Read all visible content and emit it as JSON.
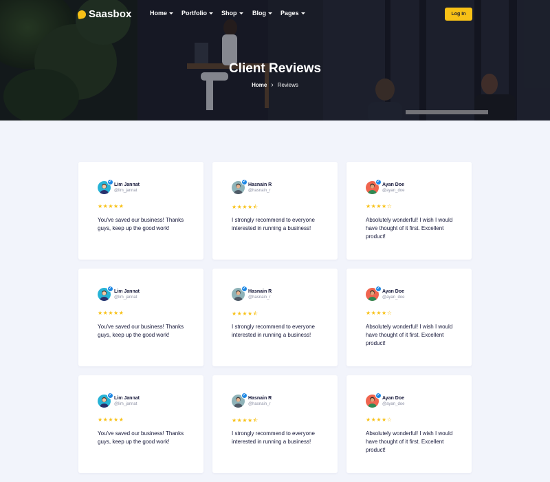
{
  "header": {
    "logo": "Saasbox",
    "menu": [
      {
        "label": "Home"
      },
      {
        "label": "Portfolio"
      },
      {
        "label": "Shop"
      },
      {
        "label": "Blog"
      },
      {
        "label": "Pages"
      }
    ],
    "login_label": "Log In"
  },
  "hero": {
    "title": "Client Reviews",
    "breadcrumb_home": "Home",
    "breadcrumb_separator": "›",
    "breadcrumb_current": "Reviews"
  },
  "colors": {
    "accent": "#f8c116",
    "verified": "#1e88e5",
    "background": "#f2f4fb"
  },
  "reviews": [
    {
      "name": "Lim Jannat",
      "handle": "@lim_jannat",
      "stars": "★★★★★",
      "text": "You've saved our business! Thanks guys, keep up the good work!",
      "avatar_bg": "#27b3d6",
      "rating": 5
    },
    {
      "name": "Hasnain R",
      "handle": "@hasnain_r",
      "stars": "★★★★⯪",
      "text": "I strongly recommend to everyone interested in running a business!",
      "avatar_bg": "#8fb3b8",
      "rating": 4.5
    },
    {
      "name": "Ayan Doe",
      "handle": "@ayan_doe",
      "stars": "★★★★☆",
      "text": "Absolutely wonderful! I wish I would have thought of it first. Excellent product!",
      "avatar_bg": "#f0654f",
      "rating": 4
    },
    {
      "name": "Lim Jannat",
      "handle": "@lim_jannat",
      "stars": "★★★★★",
      "text": "You've saved our business! Thanks guys, keep up the good work!",
      "avatar_bg": "#27b3d6",
      "rating": 5
    },
    {
      "name": "Hasnain R",
      "handle": "@hasnain_r",
      "stars": "★★★★⯪",
      "text": "I strongly recommend to everyone interested in running a business!",
      "avatar_bg": "#8fb3b8",
      "rating": 4.5
    },
    {
      "name": "Ayan Doe",
      "handle": "@ayan_doe",
      "stars": "★★★★☆",
      "text": "Absolutely wonderful! I wish I would have thought of it first. Excellent product!",
      "avatar_bg": "#f0654f",
      "rating": 4
    },
    {
      "name": "Lim Jannat",
      "handle": "@lim_jannat",
      "stars": "★★★★★",
      "text": "You've saved our business! Thanks guys, keep up the good work!",
      "avatar_bg": "#27b3d6",
      "rating": 5
    },
    {
      "name": "Hasnain R",
      "handle": "@hasnain_r",
      "stars": "★★★★⯪",
      "text": "I strongly recommend to everyone interested in running a business!",
      "avatar_bg": "#8fb3b8",
      "rating": 4.5
    },
    {
      "name": "Ayan Doe",
      "handle": "@ayan_doe",
      "stars": "★★★★☆",
      "text": "Absolutely wonderful! I wish I would have thought of it first. Excellent product!",
      "avatar_bg": "#f0654f",
      "rating": 4
    }
  ]
}
